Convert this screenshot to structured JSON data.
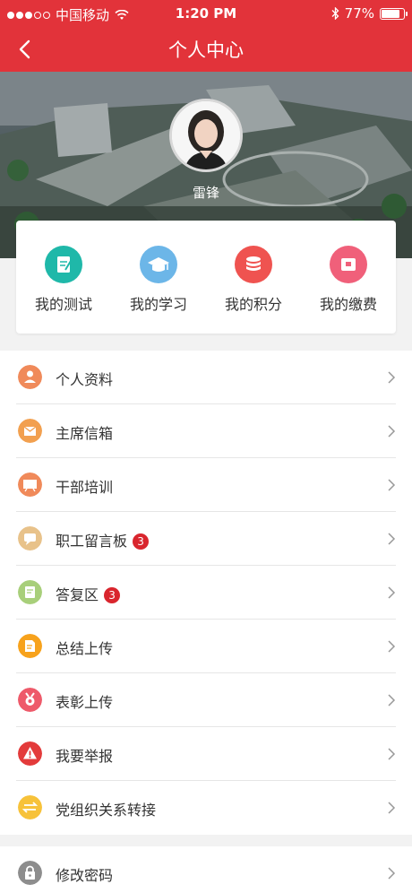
{
  "status_bar": {
    "carrier": "中国移动",
    "time": "1:20 PM",
    "battery": "77%",
    "battery_level": 0.77
  },
  "nav": {
    "title": "个人中心"
  },
  "profile": {
    "name": "雷锋"
  },
  "quick_actions": [
    {
      "label": "我的测试",
      "icon": "edit-note-icon",
      "color": "#1fb8a9"
    },
    {
      "label": "我的学习",
      "icon": "graduation-cap-icon",
      "color": "#6cb6e8"
    },
    {
      "label": "我的积分",
      "icon": "coin-stack-icon",
      "color": "#ef5350"
    },
    {
      "label": "我的缴费",
      "icon": "wallet-icon",
      "color": "#f0607a"
    }
  ],
  "menu": [
    {
      "label": "个人资料",
      "icon": "profile-card-icon",
      "color": "#f08a5a",
      "badge": ""
    },
    {
      "label": "主席信箱",
      "icon": "mailbox-icon",
      "color": "#f2a04f",
      "badge": ""
    },
    {
      "label": "干部培训",
      "icon": "training-board-icon",
      "color": "#f08a5a",
      "badge": ""
    },
    {
      "label": "职工留言板",
      "icon": "message-board-icon",
      "color": "#e8c28a",
      "badge": "3"
    },
    {
      "label": "答复区",
      "icon": "reply-doc-icon",
      "color": "#a8cf7a",
      "badge": "3"
    },
    {
      "label": "总结上传",
      "icon": "summary-upload-icon",
      "color": "#f7a21c",
      "badge": ""
    },
    {
      "label": "表彰上传",
      "icon": "medal-icon",
      "color": "#ee5a6a",
      "badge": ""
    },
    {
      "label": "我要举报",
      "icon": "warning-icon",
      "color": "#e33b3b",
      "badge": ""
    },
    {
      "label": "党组织关系转接",
      "icon": "transfer-arrows-icon",
      "color": "#f7c23a",
      "badge": ""
    }
  ],
  "menu2": [
    {
      "label": "修改密码",
      "icon": "lock-icon",
      "color": "#8d8d8d"
    }
  ]
}
